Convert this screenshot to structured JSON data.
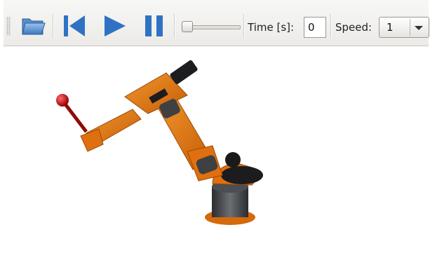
{
  "toolbar": {
    "open_icon": "folder-open-icon",
    "rewind_icon": "skip-to-start-icon",
    "play_icon": "play-icon",
    "pause_icon": "pause-icon",
    "time_label": "Time [s]:",
    "time_value": "0",
    "speed_label": "Speed:",
    "speed_value": "1",
    "playback_position": 0
  },
  "colors": {
    "accent_blue": "#2f72c4",
    "robot_orange": "#e0700f",
    "robot_gray": "#3e4042",
    "end_effector_red": "#c81010"
  }
}
